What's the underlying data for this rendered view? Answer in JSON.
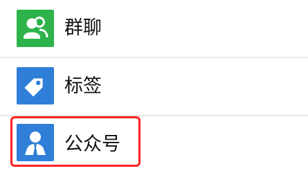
{
  "list": {
    "items": [
      {
        "label": "群聊",
        "icon": "group-chat-icon",
        "icon_color": "#2db34a"
      },
      {
        "label": "标签",
        "icon": "tag-icon",
        "icon_color": "#2f7fd8"
      },
      {
        "label": "公众号",
        "icon": "official-account-icon",
        "icon_color": "#2f7fd8"
      }
    ]
  },
  "annotation": {
    "highlight_color": "#ff1f1f",
    "highlighted_item": "公众号"
  }
}
